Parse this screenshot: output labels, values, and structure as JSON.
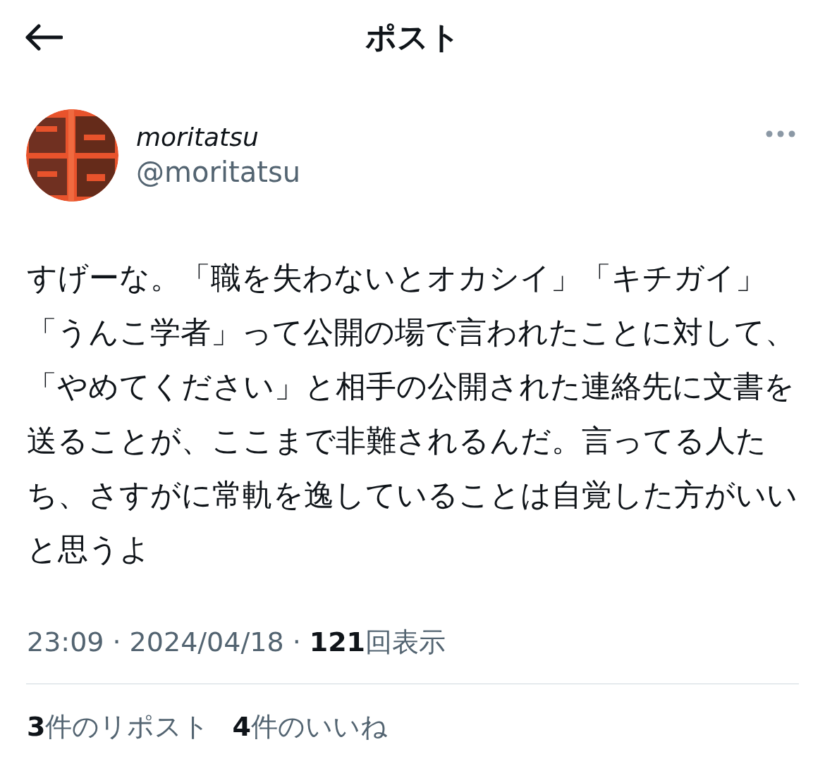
{
  "header": {
    "title": "ポスト"
  },
  "post": {
    "author": {
      "display_name": "moritatsu",
      "handle": "@moritatsu"
    },
    "text": "すげーな。「職を失わないとオカシイ」「キチガイ」「うんこ学者」って公開の場で言われたことに対して、「やめてください」と相手の公開された連絡先に文書を送ることが、ここまで非難されるんだ。言ってる人たち、さすがに常軌を逸していることは自覚した方がいいと思うよ",
    "meta": {
      "time": "23:09",
      "separator": "·",
      "date": "2024/04/18",
      "views_count": "121",
      "views_label": "回表示"
    },
    "stats": [
      {
        "count": "3",
        "label": "件のリポスト"
      },
      {
        "count": "4",
        "label": "件のいいね"
      }
    ]
  }
}
